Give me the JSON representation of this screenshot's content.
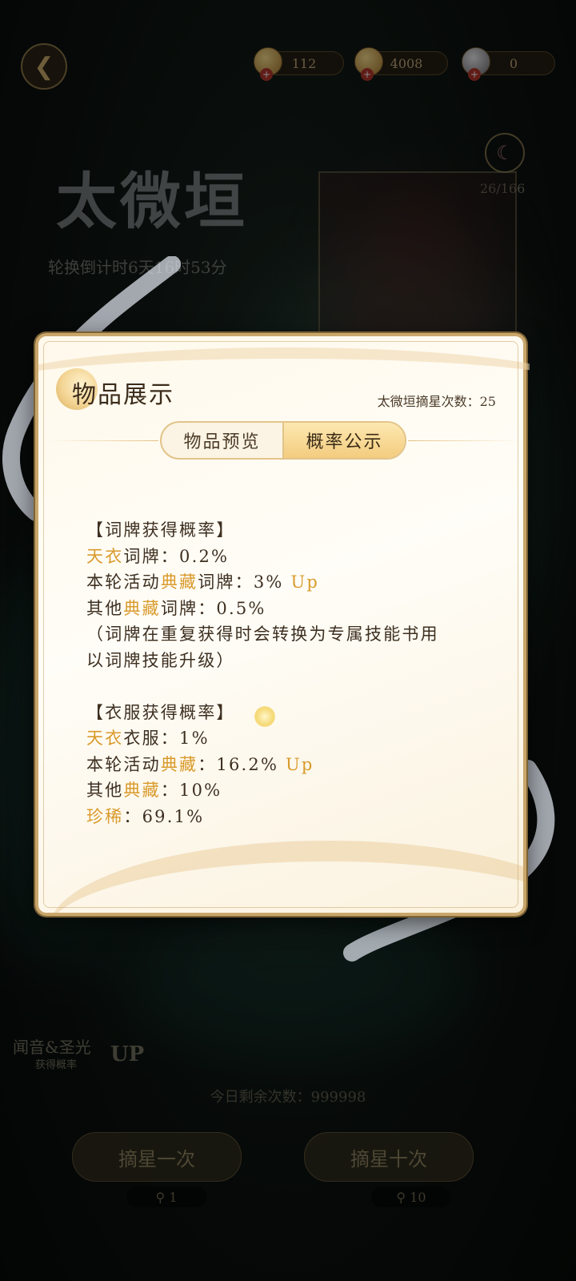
{
  "topbar": {
    "currencies": [
      {
        "icon": "gem-icon",
        "value": "112"
      },
      {
        "icon": "gold-coin-icon",
        "value": "4008"
      },
      {
        "icon": "pearl-icon",
        "value": "0"
      }
    ]
  },
  "background": {
    "event_title": "太微垣",
    "countdown": "轮换倒计时6天16时53分",
    "star_progress": "26/166",
    "up_banner": {
      "title": "闻音&圣光",
      "subtitle": "获得概率",
      "up": "UP"
    },
    "today_limit": "今日剩余次数：999998",
    "draw_once": {
      "label": "摘星一次",
      "cost": "1"
    },
    "draw_ten": {
      "label": "摘星十次",
      "cost": "10"
    }
  },
  "modal": {
    "title": "物品展示",
    "star_count_label": "太微垣摘星次数：25",
    "tabs": [
      {
        "label": "物品预览",
        "active": false
      },
      {
        "label": "概率公示",
        "active": true
      }
    ],
    "sections": {
      "card": {
        "header": "【词牌获得概率】",
        "tianyi_prefix": "天衣",
        "tianyi_text": "词牌：0.2%",
        "current_text_a": "本轮活动",
        "current_highlight": "典藏",
        "current_text_b": "词牌：3%",
        "current_up": "Up",
        "other_text_a": "其他",
        "other_highlight": "典藏",
        "other_text_b": "词牌：0.5%",
        "note_line1": "（词牌在重复获得时会转换为专属技能书用",
        "note_line2": "以词牌技能升级）"
      },
      "clothes": {
        "header": "【衣服获得概率】",
        "tianyi_prefix": "天衣",
        "tianyi_text": "衣服：1%",
        "current_text_a": "本轮活动",
        "current_highlight": "典藏",
        "current_text_b": "：16.2%",
        "current_up": "Up",
        "other_text_a": "其他",
        "other_highlight": "典藏",
        "other_text_b": "：10%",
        "rare_label": "珍稀",
        "rare_text": "：69.1%"
      }
    }
  }
}
